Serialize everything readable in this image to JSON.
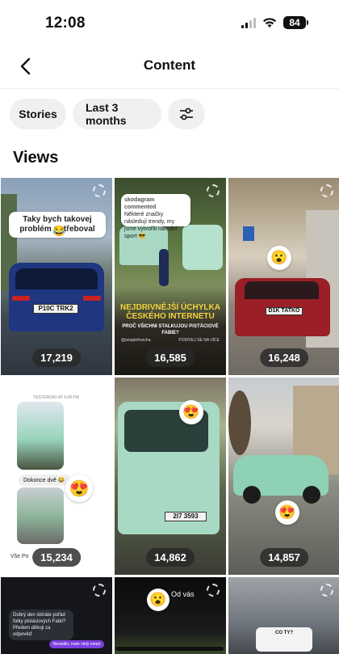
{
  "status_bar": {
    "time": "12:08",
    "battery": "84"
  },
  "header": {
    "title": "Content"
  },
  "filters": {
    "type_label": "Stories",
    "period_label": "Last 3 months"
  },
  "section": {
    "title": "Views"
  },
  "stories": [
    {
      "views": "17,219",
      "overlay_text": "Taky bych takovej problém potřeboval",
      "plate": "P10C TRK2"
    },
    {
      "views": "16,585",
      "headline": "NEJDRIVNĚJŠÍ ÚCHYLKA ČESKÉHO INTERNETU",
      "subline": "PROČ VŠICHNI STALKUJOU PISTÁCIOVÉ FABIE?",
      "quote_account": "skodagram commented",
      "quote_text": "Některé značky následují trendy, my jsme vytvořili národní sport 😎",
      "footer_left": "@peoplefrozcha",
      "footer_right": "PODÍVEJ SE NA VÍCE"
    },
    {
      "views": "16,248",
      "plate": "D1K TATKO"
    },
    {
      "views": "15,234",
      "chat_time": "YESTERDAY AT 6:58 PM",
      "chat_text": "Dokonce dvě 😂",
      "chat_reply": "Vše Po"
    },
    {
      "views": "14,862",
      "plate": "2I7 3593"
    },
    {
      "views": "14,857"
    },
    {
      "dm_text": "Dobrý den sbíráte pořád fotky pistáciových Fabií? Předem děkuji za odpověď",
      "dm_reply": "Nevadilo, mate vtely nenpr"
    },
    {
      "caption": "Od vás"
    },
    {
      "caption": "CO TY?"
    }
  ]
}
